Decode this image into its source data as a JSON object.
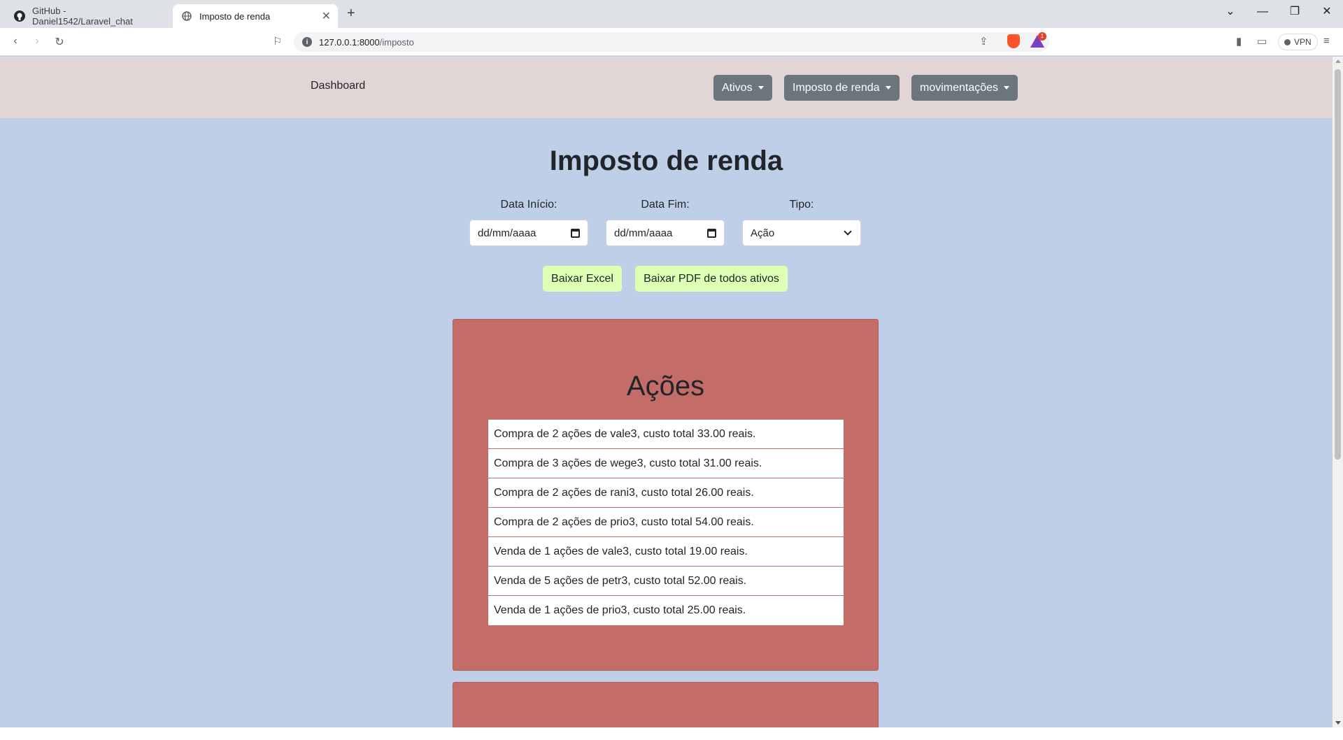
{
  "browser": {
    "tabs": [
      {
        "title": "GitHub - Daniel1542/Laravel_chat",
        "icon": "github-icon"
      },
      {
        "title": "Imposto de renda",
        "icon": "globe-icon"
      }
    ],
    "url_host": "127.0.0.1:8000",
    "url_path": "/imposto",
    "vpn_label": "VPN",
    "rewards_badge": "1"
  },
  "navbar": {
    "brand": "Dashboard",
    "menus": [
      "Ativos",
      "Imposto de renda",
      "movimentações"
    ]
  },
  "page": {
    "title": "Imposto de renda",
    "filters": {
      "start_label": "Data Início:",
      "start_value": "dd/mm/aaaa",
      "end_label": "Data Fim:",
      "end_value": "dd/mm/aaaa",
      "type_label": "Tipo:",
      "type_value": "Ação"
    },
    "buttons": {
      "excel": "Baixar Excel",
      "pdf": "Baixar PDF de todos ativos"
    },
    "acoes_card": {
      "title": "Ações",
      "items": [
        "Compra de 2 ações de vale3, custo total 33.00 reais.",
        "Compra de 3 ações de wege3, custo total 31.00 reais.",
        "Compra de 2 ações de rani3, custo total 26.00 reais.",
        "Compra de 2 ações de prio3, custo total 54.00 reais.",
        "Venda de 1 ações de vale3, custo total 19.00 reais.",
        "Venda de 5 ações de petr3, custo total 52.00 reais.",
        "Venda de 1 ações de prio3, custo total 25.00 reais."
      ]
    }
  },
  "colors": {
    "navbar_bg": "#e2d5d5",
    "page_bg": "#bfcfe8",
    "card_bg": "#c46d68",
    "download_btn_bg": "#dfffb5",
    "menu_btn_bg": "#6c757d"
  }
}
